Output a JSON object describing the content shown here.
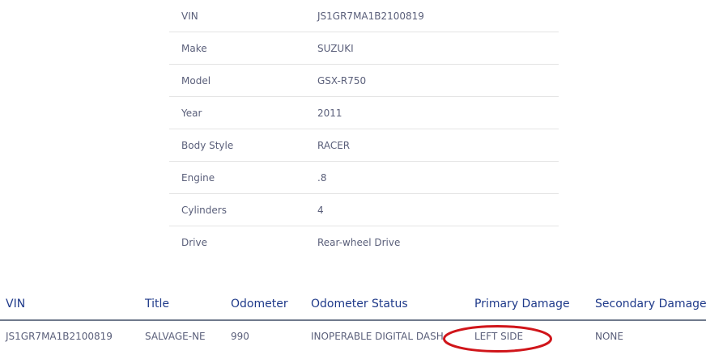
{
  "specs": [
    {
      "label": "VIN",
      "value": "JS1GR7MA1B2100819"
    },
    {
      "label": "Make",
      "value": "SUZUKI"
    },
    {
      "label": "Model",
      "value": "GSX-R750"
    },
    {
      "label": "Year",
      "value": "2011"
    },
    {
      "label": "Body Style",
      "value": "RACER"
    },
    {
      "label": "Engine",
      "value": ".8"
    },
    {
      "label": "Cylinders",
      "value": "4"
    },
    {
      "label": "Drive",
      "value": "Rear-wheel Drive"
    }
  ],
  "lots": {
    "headers": [
      "VIN",
      "Title",
      "Odometer",
      "Odometer Status",
      "Primary Damage",
      "Secondary Damage"
    ],
    "rows": [
      [
        "JS1GR7MA1B2100819",
        "SALVAGE-NE",
        "990",
        "INOPERABLE DIGITAL DASH",
        "LEFT SIDE",
        "NONE"
      ]
    ]
  },
  "colors": {
    "header_text": "#1f3a8a",
    "body_text": "#5a5f7a",
    "highlight": "#d0151a"
  }
}
